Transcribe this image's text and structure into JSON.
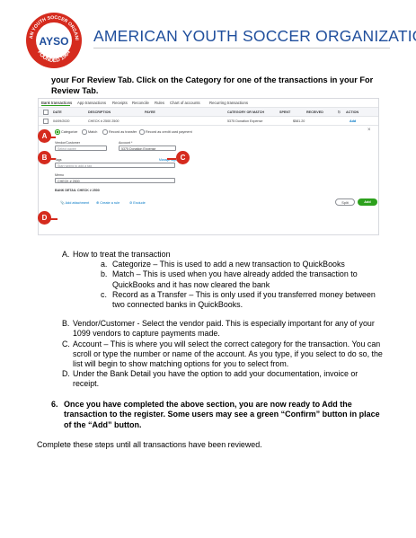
{
  "header": {
    "logo_text": {
      "top": "AMERICAN YOUTH SOCCER ORGANIZATION",
      "letters": "AYSO",
      "bottom": "FOUNDED 1964"
    },
    "title": "AMERICAN YOUTH SOCCER ORGANIZATION",
    "colors": {
      "brand_blue": "#1f4e9c",
      "brand_red": "#d52b1e"
    }
  },
  "intro": "your For Review Tab.  Click on the Category for one of the transactions in your For Review Tab.",
  "screenshot": {
    "tabs": [
      "Bank transactions",
      "App transactions",
      "Receipts",
      "Reconcile",
      "Rules",
      "Chart of accounts",
      "Recurring transactions"
    ],
    "columns": [
      "DATE",
      "DESCRIPTION",
      "PAYEE",
      "CATEGORY OR MATCH",
      "SPENT",
      "RECEIVED",
      "ACTION"
    ],
    "row": {
      "date": "04/09/2020",
      "description": "CHECK # 2500 2500",
      "payee": "",
      "category": "5375 Donation Expense",
      "spent": "$581.20",
      "received": "",
      "action": "Add"
    },
    "radios": [
      "Categorize",
      "Match",
      "Record as transfer",
      "Record as credit card payment"
    ],
    "vendor_label": "Vendor/Customer",
    "vendor_placeholder": "Select payee",
    "account_label": "Account *",
    "account_value": "5375 Donation Expense",
    "tags_label": "Tags",
    "manage_tags": "Manage tags",
    "tags_placeholder": "Start typing to add a tag",
    "memo_label": "Memo",
    "memo_value": "CHECK # 2500",
    "bank_detail": "BANK DETAIL  CHECK # 2500",
    "add_attachment": "Add attachment",
    "create_rule": "Create a rule",
    "exclude": "Exclude",
    "split": "Split",
    "add": "Add",
    "callouts": [
      "A",
      "B",
      "C",
      "D"
    ]
  },
  "list": {
    "a": {
      "marker": "A.",
      "text": "How to treat the transaction"
    },
    "a_items": [
      {
        "marker": "a.",
        "text": "Categorize – This is used to add a new transaction to QuickBooks"
      },
      {
        "marker": "b.",
        "text": "Match – This is used when you have already added the transaction to QuickBooks and it has now cleared the bank"
      },
      {
        "marker": "c.",
        "text": "Record as a Transfer – This is only used if you transferred money between two connected banks in QuickBooks."
      }
    ],
    "b": {
      "marker": "B.",
      "text": "Vendor/Customer  - Select the vendor paid.  This is especially important for any of your 1099 vendors to capture payments made."
    },
    "c": {
      "marker": "C.",
      "text": "Account – This is where you will select the correct category for the transaction.  You can scroll or type the number or name of the account.  As you type, if you select to do so, the list will begin to show matching options for you to select from."
    },
    "d": {
      "marker": "D.",
      "text": "Under the Bank Detail you have the option to add your documentation, invoice or receipt."
    }
  },
  "step6": {
    "marker": "6.",
    "text": "Once you have completed the above section, you are now ready to Add the transaction to the register.  Some users may see a green “Confirm” button in place of the “Add” button."
  },
  "closing": "Complete these steps until all transactions have been reviewed."
}
